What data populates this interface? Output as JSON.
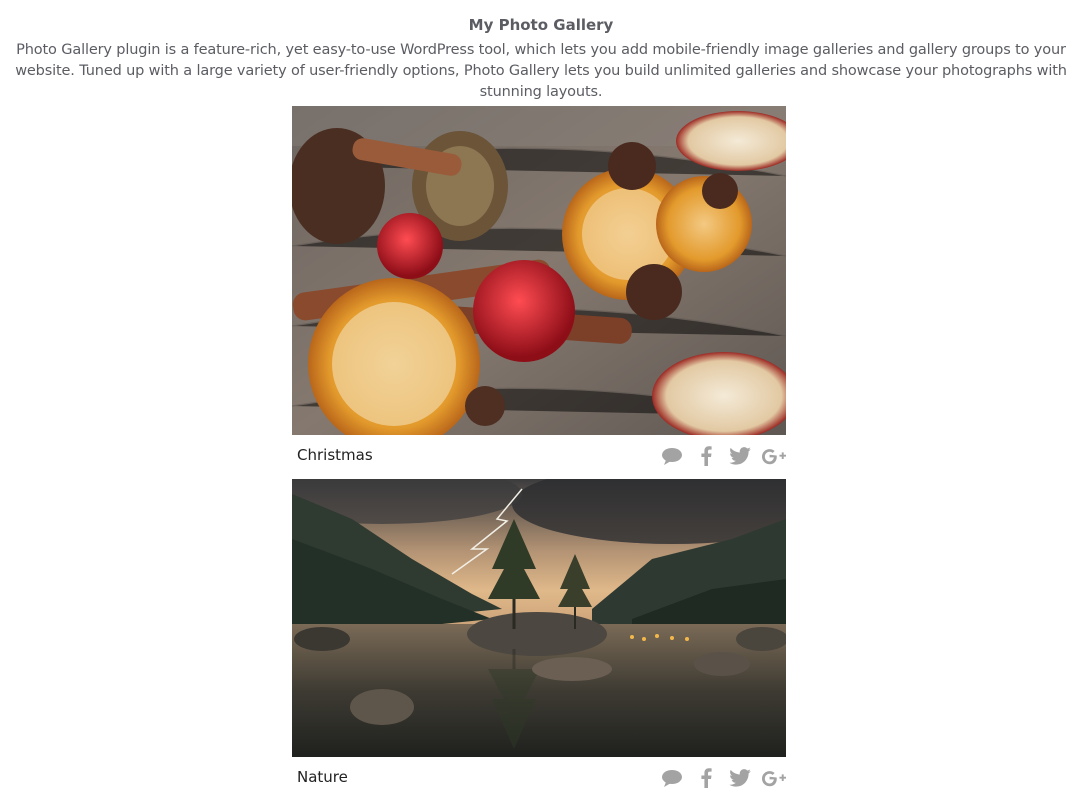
{
  "gallery": {
    "title": "My Photo Gallery",
    "description": "Photo Gallery plugin is a feature-rich, yet easy-to-use WordPress tool, which lets you add mobile-friendly image galleries and gallery groups to your website. Tuned up with a large variety of user-friendly options, Photo Gallery lets you build unlimited galleries and showcase your photographs with stunning layouts."
  },
  "items": [
    {
      "caption": "Christmas",
      "image_subject": "Dried orange slices, pine cones, rambutans, cinnamon sticks and star anise on a wooden table",
      "share_icons": [
        "comment-icon",
        "facebook-icon",
        "twitter-icon",
        "google-plus-icon"
      ]
    },
    {
      "caption": "Nature",
      "image_subject": "Lake with rocky islet and trees, mountains and stormy sky with lightning",
      "share_icons": [
        "comment-icon",
        "facebook-icon",
        "twitter-icon",
        "google-plus-icon"
      ]
    }
  ],
  "colors": {
    "text": "#5b5d63",
    "caption": "#222222",
    "icon": "#a3a3a3"
  }
}
